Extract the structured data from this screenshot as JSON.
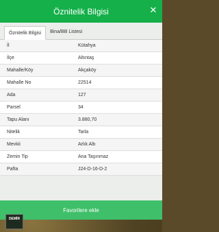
{
  "header": {
    "title": "Öznitelik Bilgisi",
    "close_glyph": "✕"
  },
  "tabs": [
    {
      "label": "Öznitelik Bilgisi",
      "active": true
    },
    {
      "label": "Bina/BB Listesi",
      "active": false
    }
  ],
  "attributes": [
    {
      "key": "İl",
      "value": "Kütahya"
    },
    {
      "key": "İlçe",
      "value": "Altıntaş"
    },
    {
      "key": "Mahalle/Köy",
      "value": "Akçaköy"
    },
    {
      "key": "Mahalle No",
      "value": "22514"
    },
    {
      "key": "Ada",
      "value": "127"
    },
    {
      "key": "Parsel",
      "value": "34"
    },
    {
      "key": "Tapu Alanı",
      "value": "3.880,70"
    },
    {
      "key": "Nitelik",
      "value": "Tarla"
    },
    {
      "key": "Mevkii",
      "value": "Arlık Altı"
    },
    {
      "key": "Zemin Tip",
      "value": "Ana Taşınmaz"
    },
    {
      "key": "Pafta",
      "value": "J24-D-16-D-2"
    }
  ],
  "favorites_button": {
    "label": "Favorilere ekle"
  },
  "logo": {
    "text": "DEMİR"
  },
  "colors": {
    "header_green": "#15b04a",
    "button_green": "#3fbf6a"
  }
}
